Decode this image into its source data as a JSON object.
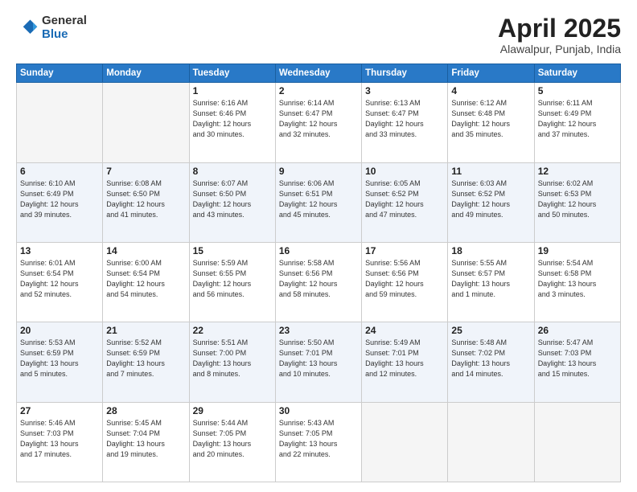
{
  "header": {
    "logo_general": "General",
    "logo_blue": "Blue",
    "month_title": "April 2025",
    "location": "Alawalpur, Punjab, India"
  },
  "days_of_week": [
    "Sunday",
    "Monday",
    "Tuesday",
    "Wednesday",
    "Thursday",
    "Friday",
    "Saturday"
  ],
  "weeks": [
    [
      {
        "num": "",
        "info": ""
      },
      {
        "num": "",
        "info": ""
      },
      {
        "num": "1",
        "info": "Sunrise: 6:16 AM\nSunset: 6:46 PM\nDaylight: 12 hours\nand 30 minutes."
      },
      {
        "num": "2",
        "info": "Sunrise: 6:14 AM\nSunset: 6:47 PM\nDaylight: 12 hours\nand 32 minutes."
      },
      {
        "num": "3",
        "info": "Sunrise: 6:13 AM\nSunset: 6:47 PM\nDaylight: 12 hours\nand 33 minutes."
      },
      {
        "num": "4",
        "info": "Sunrise: 6:12 AM\nSunset: 6:48 PM\nDaylight: 12 hours\nand 35 minutes."
      },
      {
        "num": "5",
        "info": "Sunrise: 6:11 AM\nSunset: 6:49 PM\nDaylight: 12 hours\nand 37 minutes."
      }
    ],
    [
      {
        "num": "6",
        "info": "Sunrise: 6:10 AM\nSunset: 6:49 PM\nDaylight: 12 hours\nand 39 minutes."
      },
      {
        "num": "7",
        "info": "Sunrise: 6:08 AM\nSunset: 6:50 PM\nDaylight: 12 hours\nand 41 minutes."
      },
      {
        "num": "8",
        "info": "Sunrise: 6:07 AM\nSunset: 6:50 PM\nDaylight: 12 hours\nand 43 minutes."
      },
      {
        "num": "9",
        "info": "Sunrise: 6:06 AM\nSunset: 6:51 PM\nDaylight: 12 hours\nand 45 minutes."
      },
      {
        "num": "10",
        "info": "Sunrise: 6:05 AM\nSunset: 6:52 PM\nDaylight: 12 hours\nand 47 minutes."
      },
      {
        "num": "11",
        "info": "Sunrise: 6:03 AM\nSunset: 6:52 PM\nDaylight: 12 hours\nand 49 minutes."
      },
      {
        "num": "12",
        "info": "Sunrise: 6:02 AM\nSunset: 6:53 PM\nDaylight: 12 hours\nand 50 minutes."
      }
    ],
    [
      {
        "num": "13",
        "info": "Sunrise: 6:01 AM\nSunset: 6:54 PM\nDaylight: 12 hours\nand 52 minutes."
      },
      {
        "num": "14",
        "info": "Sunrise: 6:00 AM\nSunset: 6:54 PM\nDaylight: 12 hours\nand 54 minutes."
      },
      {
        "num": "15",
        "info": "Sunrise: 5:59 AM\nSunset: 6:55 PM\nDaylight: 12 hours\nand 56 minutes."
      },
      {
        "num": "16",
        "info": "Sunrise: 5:58 AM\nSunset: 6:56 PM\nDaylight: 12 hours\nand 58 minutes."
      },
      {
        "num": "17",
        "info": "Sunrise: 5:56 AM\nSunset: 6:56 PM\nDaylight: 12 hours\nand 59 minutes."
      },
      {
        "num": "18",
        "info": "Sunrise: 5:55 AM\nSunset: 6:57 PM\nDaylight: 13 hours\nand 1 minute."
      },
      {
        "num": "19",
        "info": "Sunrise: 5:54 AM\nSunset: 6:58 PM\nDaylight: 13 hours\nand 3 minutes."
      }
    ],
    [
      {
        "num": "20",
        "info": "Sunrise: 5:53 AM\nSunset: 6:59 PM\nDaylight: 13 hours\nand 5 minutes."
      },
      {
        "num": "21",
        "info": "Sunrise: 5:52 AM\nSunset: 6:59 PM\nDaylight: 13 hours\nand 7 minutes."
      },
      {
        "num": "22",
        "info": "Sunrise: 5:51 AM\nSunset: 7:00 PM\nDaylight: 13 hours\nand 8 minutes."
      },
      {
        "num": "23",
        "info": "Sunrise: 5:50 AM\nSunset: 7:01 PM\nDaylight: 13 hours\nand 10 minutes."
      },
      {
        "num": "24",
        "info": "Sunrise: 5:49 AM\nSunset: 7:01 PM\nDaylight: 13 hours\nand 12 minutes."
      },
      {
        "num": "25",
        "info": "Sunrise: 5:48 AM\nSunset: 7:02 PM\nDaylight: 13 hours\nand 14 minutes."
      },
      {
        "num": "26",
        "info": "Sunrise: 5:47 AM\nSunset: 7:03 PM\nDaylight: 13 hours\nand 15 minutes."
      }
    ],
    [
      {
        "num": "27",
        "info": "Sunrise: 5:46 AM\nSunset: 7:03 PM\nDaylight: 13 hours\nand 17 minutes."
      },
      {
        "num": "28",
        "info": "Sunrise: 5:45 AM\nSunset: 7:04 PM\nDaylight: 13 hours\nand 19 minutes."
      },
      {
        "num": "29",
        "info": "Sunrise: 5:44 AM\nSunset: 7:05 PM\nDaylight: 13 hours\nand 20 minutes."
      },
      {
        "num": "30",
        "info": "Sunrise: 5:43 AM\nSunset: 7:05 PM\nDaylight: 13 hours\nand 22 minutes."
      },
      {
        "num": "",
        "info": ""
      },
      {
        "num": "",
        "info": ""
      },
      {
        "num": "",
        "info": ""
      }
    ]
  ]
}
